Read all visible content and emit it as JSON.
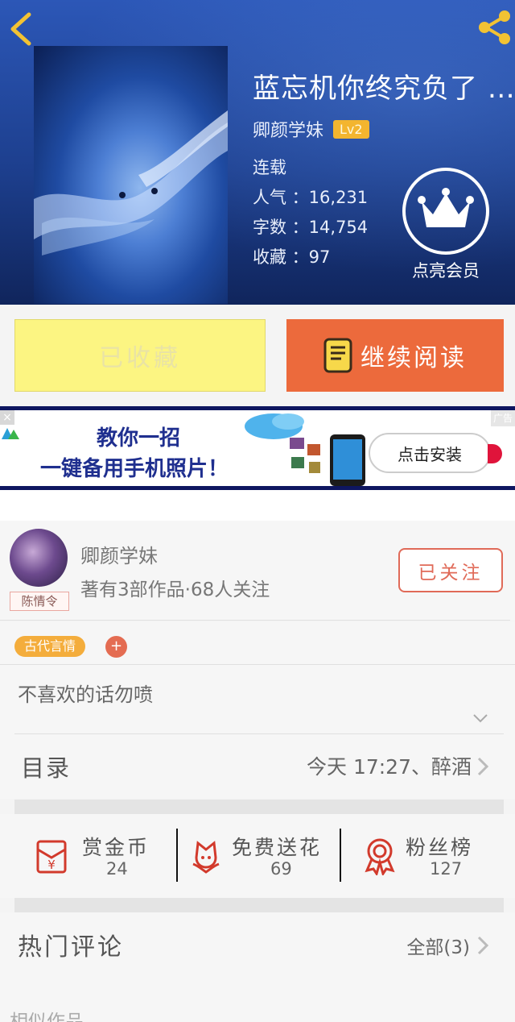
{
  "book": {
    "title": "蓝忘机你终究负了 …",
    "author": "卿颜学妹",
    "level": "Lv2",
    "status": "连载",
    "popularity_label": "人气 ：16,231",
    "words_label": "字数 ：14,754",
    "favorites_label": "收藏 ：97",
    "vip_label": "点亮会员"
  },
  "actions": {
    "favorited_label": "已收藏",
    "continue_label": "继续阅读"
  },
  "ad": {
    "close": "×",
    "tag": "广告",
    "line1": "教你一招",
    "line2": "一键备用手机照片！",
    "install_label": "点击安装"
  },
  "author_card": {
    "name": "卿颜学妹",
    "avatar_tag": "陈情令",
    "stats": "著有3部作品·68人关注",
    "follow_label": "已关注"
  },
  "tags": {
    "genre": "古代言情",
    "add": "+"
  },
  "intro": "不喜欢的话勿喷",
  "toc": {
    "label": "目录",
    "latest": "今天 17:27、醉酒"
  },
  "stats": [
    {
      "label": "赏金币",
      "value": "24",
      "icon": "red-envelope-icon"
    },
    {
      "label": "免费送花",
      "value": "69",
      "icon": "flower-icon"
    },
    {
      "label": "粉丝榜",
      "value": "127",
      "icon": "medal-icon"
    }
  ],
  "comments": {
    "title": "热门评论",
    "all_label": "全部(3)"
  },
  "similar_label": "相似作品",
  "colors": {
    "header_blue": "#1d3f8e",
    "accent_orange": "#ec6a3c",
    "fav_yellow": "#fcf582",
    "tag_orange": "#f4ad3c",
    "follow_red": "#e06a58"
  }
}
